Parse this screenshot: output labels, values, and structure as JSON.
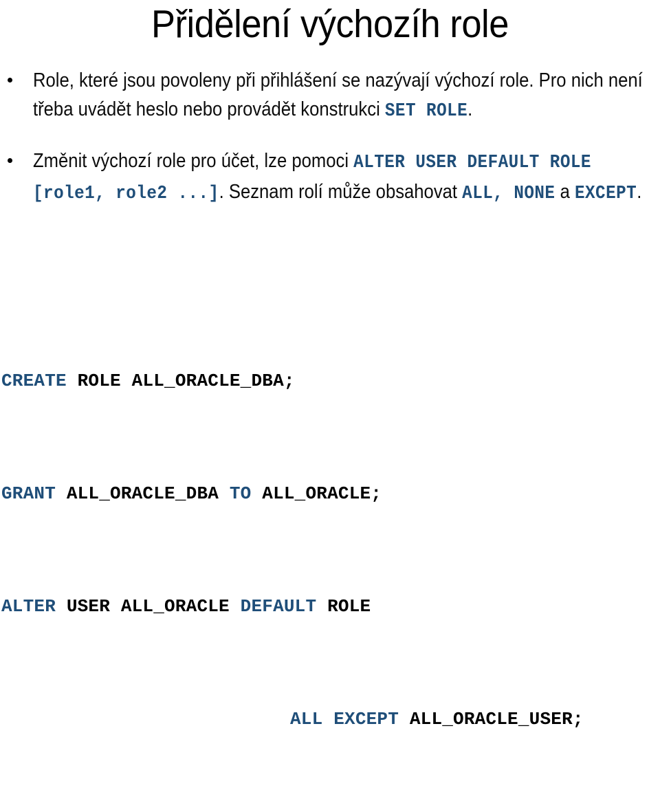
{
  "slide": {
    "title": "Přidělení výchozíh role",
    "bullets": [
      {
        "marker": "•",
        "segments": [
          {
            "kind": "text",
            "value": "Role, které jsou povoleny při přihlášení se nazývají  výchozí role. Pro nich není třeba uvádět heslo nebo provádět konstrukci "
          },
          {
            "kind": "code",
            "value": "SET ROLE"
          },
          {
            "kind": "text",
            "value": "."
          }
        ],
        "plain": "Role, které jsou povoleny při přihlášení se nazývají výchozí role. Pro nich není třeba uvádět heslo nebo provádět konstrukci SET ROLE."
      },
      {
        "marker": "•",
        "segments": [
          {
            "kind": "text",
            "value": "Změnit výchozí role pro účet, lze pomoci "
          },
          {
            "kind": "code",
            "value": "ALTER USER DEFAULT ROLE [role1, role2 ...]"
          },
          {
            "kind": "text",
            "value": ". Seznam rolí může obsahovat "
          },
          {
            "kind": "code",
            "value": "ALL, NONE"
          },
          {
            "kind": "text",
            "value": " a "
          },
          {
            "kind": "code",
            "value": "EXCEPT"
          },
          {
            "kind": "text",
            "value": "."
          }
        ],
        "plain": "Změnit výchozí role pro účet, lze pomoci ALTER USER DEFAULT ROLE [role1, role2 ...]. Seznam rolí může obsahovat ALL, NONE a EXCEPT."
      }
    ],
    "bullet1": {
      "text_a": "Role, které jsou povoleny při přihlášení se nazývají  výchozí role. Pro nich není třeba uvádět heslo nebo provádět konstrukci ",
      "code_a": "SET ROLE",
      "text_b": "."
    },
    "bullet2": {
      "text_a": "Změnit výchozí role pro účet, lze pomoci ",
      "code_a": "ALTER USER DEFAULT ROLE [role1, role2 ...]",
      "text_b": ". Seznam rolí může obsahovat ",
      "code_b": "ALL, NONE",
      "text_c": " a ",
      "code_c": "EXCEPT",
      "text_d": "."
    },
    "code_block": {
      "line1": {
        "kw1": "CREATE",
        "rest1": " ROLE ALL_ORACLE_DBA;"
      },
      "line2": {
        "kw1": "GRANT",
        "rest1": " ALL_ORACLE_DBA ",
        "kw2": "TO",
        "rest2": " ALL_ORACLE;"
      },
      "line3": {
        "kw1": "ALTER",
        "rest1": " USER ALL_ORACLE ",
        "kw2": "DEFAULT",
        "rest2": " ROLE"
      },
      "line4": {
        "kw1": "ALL EXCEPT",
        "rest1": " ALL_ORACLE_USER;"
      },
      "full_text": "CREATE ROLE ALL_ORACLE_DBA;\nGRANT ALL_ORACLE_DBA TO ALL_ORACLE;\nALTER USER ALL_ORACLE DEFAULT ROLE\n                    ALL EXCEPT ALL_ORACLE_USER;"
    }
  },
  "colors": {
    "keyword_blue": "#1F4E79",
    "text_black": "#0D0D0D",
    "background": "#FFFFFF"
  }
}
